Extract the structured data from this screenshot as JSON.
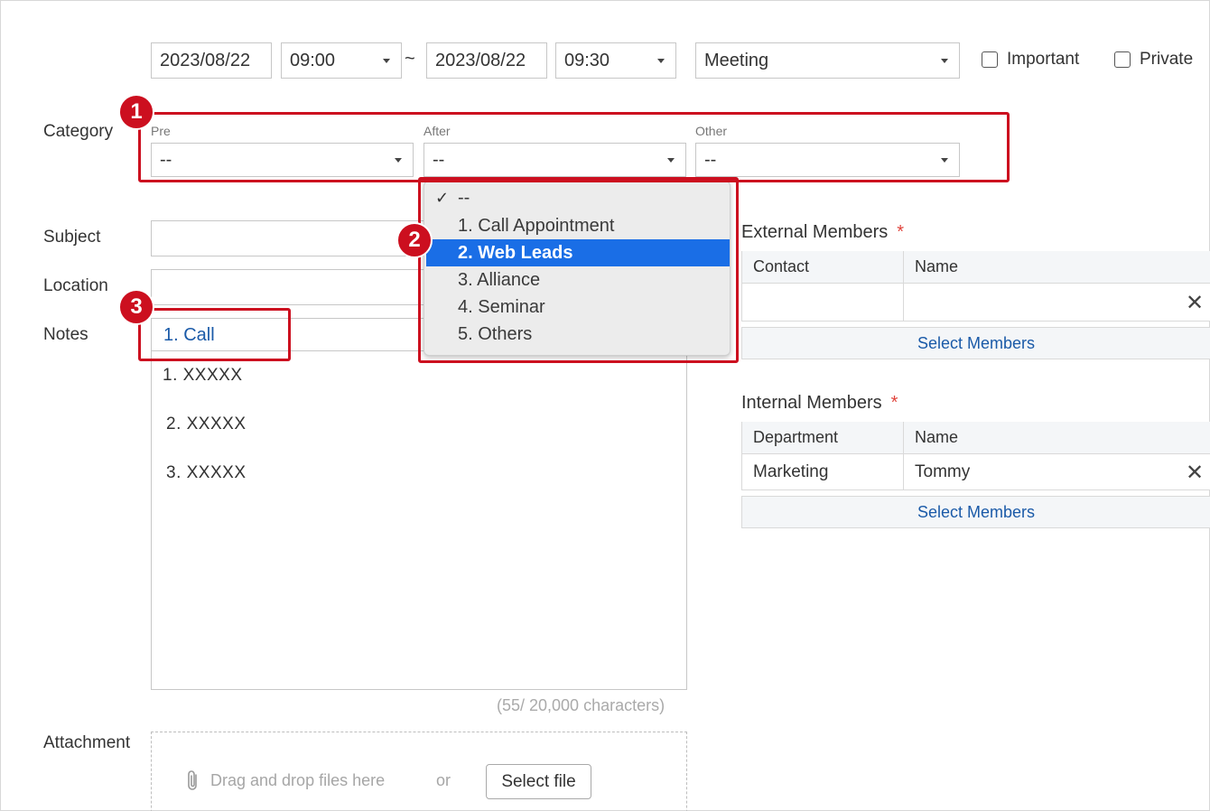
{
  "datetime": {
    "start_date": "2023/08/22",
    "start_time": "09:00",
    "separator": "~",
    "end_date": "2023/08/22",
    "end_time": "09:30",
    "type": "Meeting",
    "important_label": "Important",
    "private_label": "Private"
  },
  "category": {
    "label": "Category",
    "pre_label": "Pre",
    "pre_value": "--",
    "after_label": "After",
    "after_value": "--",
    "other_label": "Other",
    "other_value": "--"
  },
  "dropdown": {
    "options": [
      "--",
      "1. Call Appointment",
      "2. Web Leads",
      "3. Alliance",
      "4. Seminar",
      "5. Others"
    ],
    "selected_index": 2,
    "checked_index": 0
  },
  "form": {
    "subject_label": "Subject",
    "subject_value": "",
    "location_label": "Location",
    "location_value": "",
    "notes_label": "Notes",
    "notes_template": "1. Call",
    "notes_lines": [
      "1. XXXXX",
      "2. XXXXX",
      "3. XXXXX"
    ],
    "char_count": "(55/ 20,000 characters)",
    "attachment_label": "Attachment",
    "drop_text": "Drag and drop files here",
    "or_text": "or",
    "select_file": "Select file"
  },
  "external": {
    "title": "External Members",
    "required": "*",
    "col1": "Contact",
    "col2": "Name",
    "rows": [
      {
        "contact": "",
        "name": ""
      }
    ],
    "select_members": "Select Members"
  },
  "internal": {
    "title": "Internal Members",
    "required": "*",
    "col1": "Department",
    "col2": "Name",
    "rows": [
      {
        "department": "Marketing",
        "name": "Tommy"
      }
    ],
    "select_members": "Select Members"
  },
  "badges": [
    "1",
    "2",
    "3"
  ],
  "colors": {
    "highlight": "#cc0f1f",
    "selected_option": "#1a6ee6",
    "link": "#1a5aa8",
    "required": "#e0443c"
  }
}
